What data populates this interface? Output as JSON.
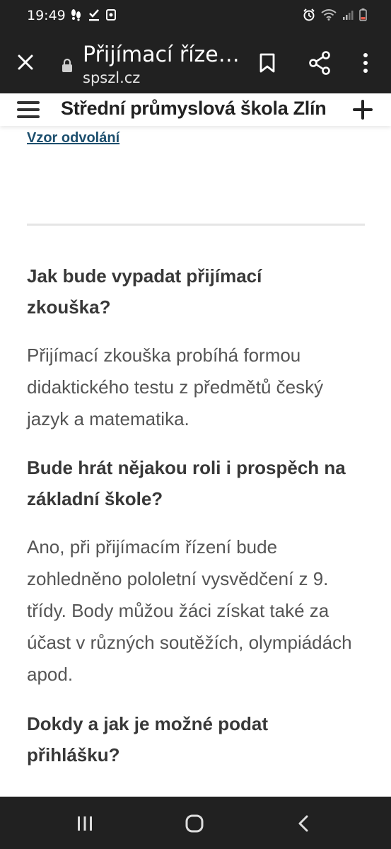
{
  "status_bar": {
    "time": "19:49"
  },
  "toolbar": {
    "title": "Přijímací říze…",
    "domain": "spszl.cz"
  },
  "site_header": {
    "title": "Střední průmyslová škola Zlín"
  },
  "content": {
    "link_text": "Vzor odvolání",
    "faq": [
      {
        "question": "Jak bude vypadat přijímací zkouška?",
        "answer": "Přijímací zkouška probíhá formou didaktického testu z předmětů český jazyk a matematika."
      },
      {
        "question": "Bude hrát nějakou roli i prospěch na základní škole?",
        "answer": "Ano, při přijímacím řízení bude zohledněno pololetní vysvědčení z 9. třídy. Body můžou žáci získat také za účast v různých soutěžích, olympiádách apod."
      },
      {
        "question": "Dokdy a jak je možné podat přihlášku?"
      }
    ]
  },
  "colors": {
    "bars": "#212121",
    "link": "#1d4f6e",
    "text": "#555555",
    "heading": "#383838"
  }
}
